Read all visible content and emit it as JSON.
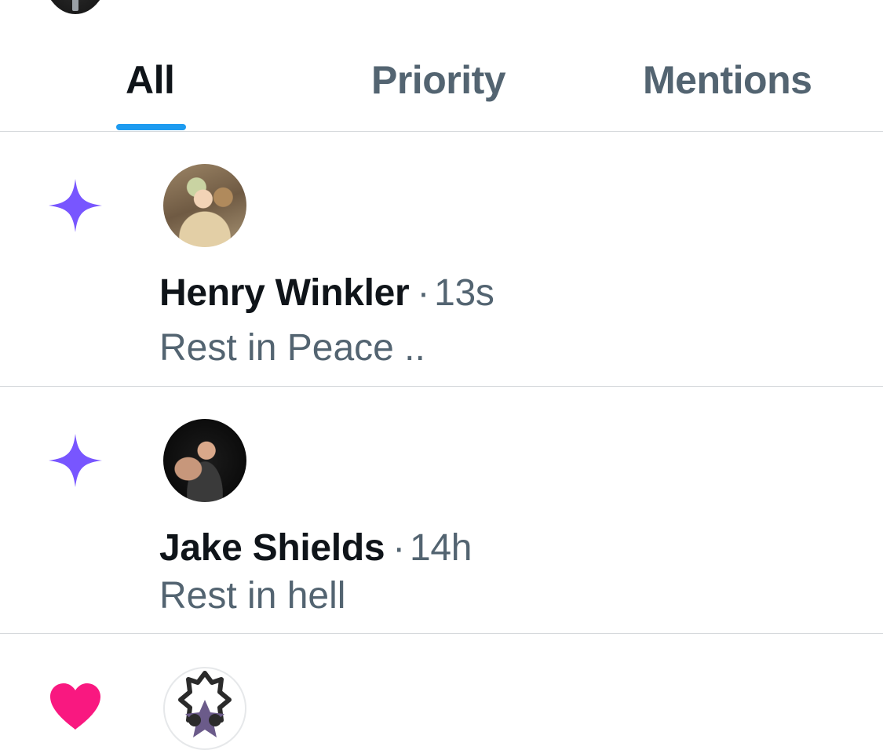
{
  "tabs": {
    "all_label": "All",
    "priority_label": "Priority",
    "mentions_label": "Mentions",
    "active": "All"
  },
  "notifications": [
    {
      "icon": "sparkle-icon",
      "icon_color": "#7856ff",
      "author": "Henry Winkler",
      "separator": "·",
      "time": "13s",
      "message": "Rest in Peace .."
    },
    {
      "icon": "sparkle-icon",
      "icon_color": "#7856ff",
      "author": "Jake Shields",
      "separator": "·",
      "time": "14h",
      "message": "Rest in hell"
    },
    {
      "icon": "heart-icon",
      "icon_color": "#f91880"
    }
  ],
  "colors": {
    "accent": "#1d9bf0",
    "text_primary": "#0f1419",
    "text_secondary": "#536471",
    "divider": "#d6d9dc"
  }
}
